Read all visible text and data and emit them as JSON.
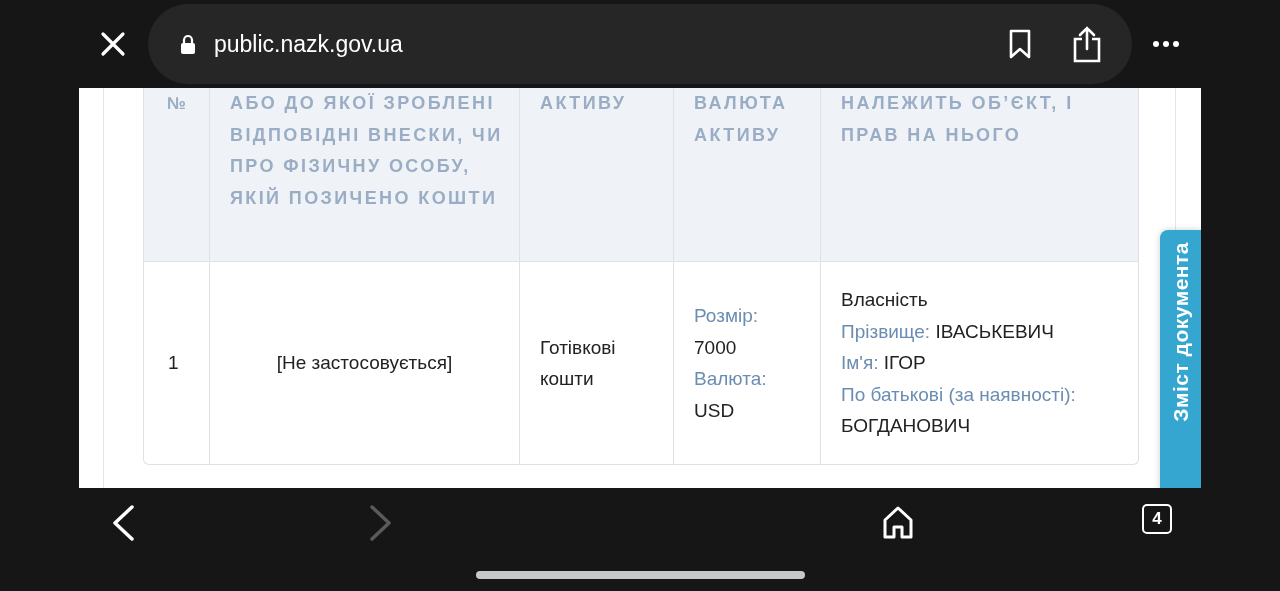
{
  "browser": {
    "url": "public.nazk.gov.ua"
  },
  "table": {
    "columns": [
      {
        "label": "№"
      },
      {
        "label": "АБО ДО ЯКОЇ ЗРОБЛЕНІ ВІДПОВІДНІ ВНЕСКИ, ЧИ ПРО ФІЗИЧНУ ОСОБУ, ЯКІЙ ПОЗИЧЕНО КОШТИ"
      },
      {
        "label": "АКТИВУ"
      },
      {
        "label": "ВАЛЮТА АКТИВУ"
      },
      {
        "label": "НАЛЕЖИТЬ ОБ’ЄКТ, І ПРАВ НА НЬОГО"
      }
    ],
    "rows": [
      {
        "number": "1",
        "description": "[Не застосовується]",
        "asset_type": "Готівкові кошти",
        "amount": [
          {
            "label": "Розмір:",
            "value": "7000"
          },
          {
            "label": "Валюта:",
            "value": "USD"
          }
        ],
        "rights": {
          "title": "Власність",
          "fields": [
            {
              "label": "Прізвище:",
              "value": "ІВАСЬКЕВИЧ"
            },
            {
              "label": "Ім'я:",
              "value": "ІГОР"
            },
            {
              "label": "По батькові (за наявності):",
              "value": "БОГДАНОВИЧ"
            }
          ]
        }
      }
    ]
  },
  "side_tab": {
    "label": "Зміст документа"
  },
  "toolbar": {
    "back_disabled": false,
    "forward_disabled": true,
    "tab_count": "4"
  }
}
